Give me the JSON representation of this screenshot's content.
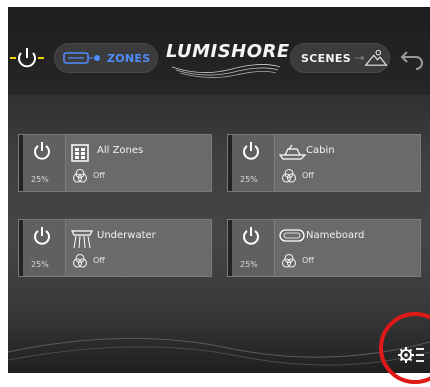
{
  "header": {
    "zones_label": "ZONES",
    "logo_text": "LUMISHORE",
    "scenes_label": "SCENES"
  },
  "zones": [
    {
      "name": "All Zones",
      "brightness": "25%",
      "state": "Off",
      "icon": "grid-icon"
    },
    {
      "name": "Cabin",
      "brightness": "25%",
      "state": "Off",
      "icon": "boat-icon"
    },
    {
      "name": "Underwater",
      "brightness": "25%",
      "state": "Off",
      "icon": "underwater-light-icon"
    },
    {
      "name": "Nameboard",
      "brightness": "25%",
      "state": "Off",
      "icon": "nameboard-icon"
    }
  ],
  "colors": {
    "accent_blue": "#4f8dff",
    "power_yellow": "#f0d200",
    "highlight_red": "#e01818"
  }
}
